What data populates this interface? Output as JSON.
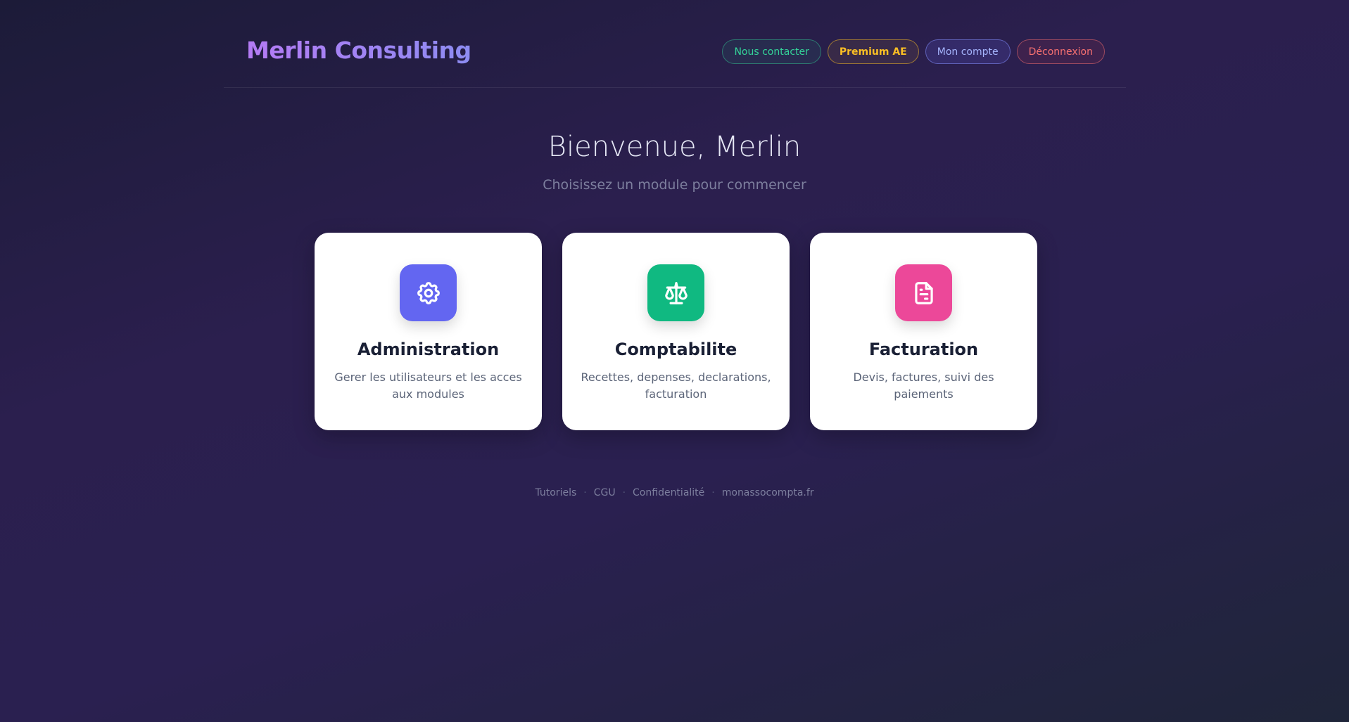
{
  "header": {
    "brand": "Merlin Consulting",
    "nav": {
      "contact": "Nous contacter",
      "premium": "Premium AE",
      "account": "Mon compte",
      "logout": "Déconnexion"
    }
  },
  "main": {
    "welcome": "Bienvenue, Merlin",
    "subtitle": "Choisissez un module pour commencer",
    "cards": [
      {
        "title": "Administration",
        "description": "Gerer les utilisateurs et les acces aux modules",
        "icon": "gear-icon",
        "color": "#6366f1"
      },
      {
        "title": "Comptabilite",
        "description": "Recettes, depenses, declarations, facturation",
        "icon": "scale-icon",
        "color": "#10b981"
      },
      {
        "title": "Facturation",
        "description": "Devis, factures, suivi des paiements",
        "icon": "document-icon",
        "color": "#ec4899"
      }
    ]
  },
  "footer": {
    "links": [
      "Tutoriels",
      "CGU",
      "Confidentialité",
      "monassocompta.fr"
    ],
    "separator": "·"
  },
  "colors": {
    "brand_gradient_start": "#b57bf5",
    "brand_gradient_end": "#8d8cf2",
    "contact": "#34d399",
    "premium": "#fbbf24",
    "account": "#a5b4fc",
    "logout": "#f87171"
  }
}
